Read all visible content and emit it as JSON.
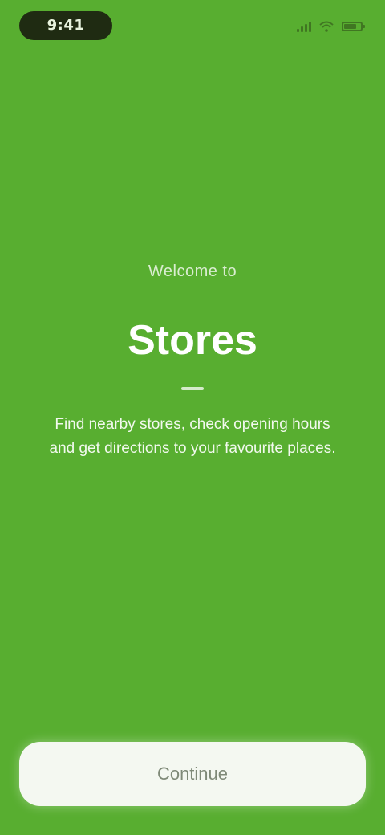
{
  "status_bar": {
    "time": "9:41",
    "icons": [
      "signal-icon",
      "wifi-icon",
      "battery-icon"
    ]
  },
  "intro": {
    "eyebrow": "Welcome to",
    "title": "Stores",
    "description": "Find nearby stores, check opening hours and get directions to your favourite places."
  },
  "action": {
    "button_label": "Continue"
  },
  "colors": {
    "background": "#58ae30",
    "button_bg": "#f4f8f1",
    "time_pill": "#1f2b12"
  }
}
